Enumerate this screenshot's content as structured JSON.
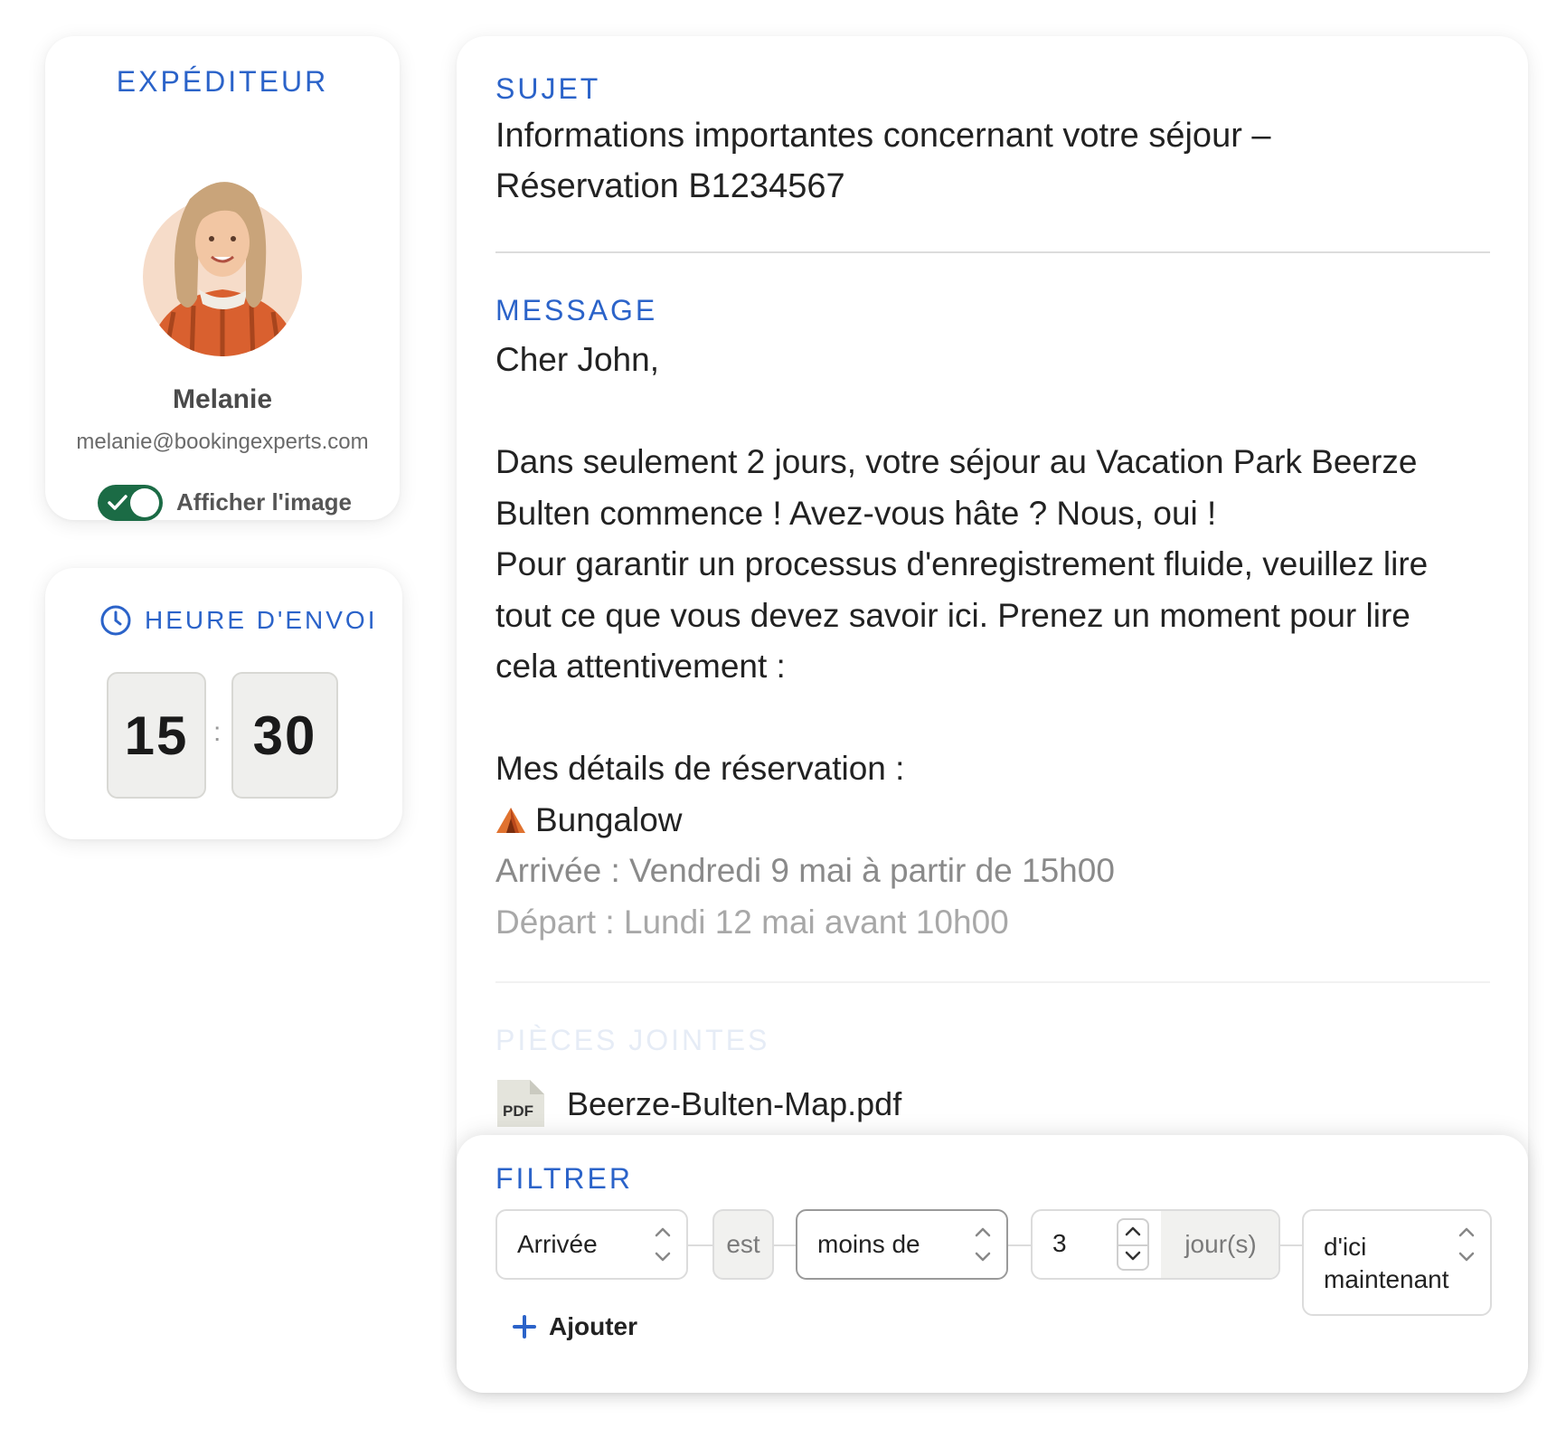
{
  "sender": {
    "label": "EXPÉDITEUR",
    "name": "Melanie",
    "email": "melanie@bookingexperts.com",
    "show_image_label": "Afficher l'image",
    "show_image_on": true
  },
  "send_time": {
    "label": "HEURE D'ENVOI",
    "hour": "15",
    "separator": ":",
    "minute": "30"
  },
  "email": {
    "subject_label": "SUJET",
    "subject_line1": "Informations importantes concernant votre séjour –",
    "subject_line2": "Réservation B1234567",
    "message_label": "MESSAGE",
    "greeting": "Cher John,",
    "para1_line1": "Dans seulement 2 jours, votre séjour au Vacation Park Beerze",
    "para1_line2": "Bulten commence ! Avez-vous hâte ? Nous, oui !",
    "para2_line1": "Pour garantir un processus d'enregistrement fluide, veuillez lire",
    "para2_line2": "tout ce que vous devez savoir ici. Prenez un moment pour lire",
    "para2_line3": "cela attentivement :",
    "details_title": "Mes détails de réservation :",
    "accommodation": "Bungalow",
    "arrival": "Arrivée : Vendredi 9 mai à partir de 15h00",
    "departure": "Départ : Lundi 12 mai avant 10h00",
    "attachments_label": "PIÈCES JOINTES",
    "attachment_type": "PDF",
    "attachment_name": "Beerze-Bulten-Map.pdf"
  },
  "filter": {
    "label": "FILTRER",
    "field": "Arrivée",
    "connector": "est",
    "operator": "moins de",
    "number": "3",
    "unit": "jour(s)",
    "relative_line1": "d'ici",
    "relative_line2": "maintenant",
    "add_label": "Ajouter"
  },
  "colors": {
    "accent_blue": "#2b63c9",
    "toggle_green": "#1b6b45"
  },
  "icons": {
    "clock": "clock-icon",
    "tent": "tent-icon",
    "pdf": "pdf-file-icon",
    "plus": "plus-icon",
    "check": "check-icon",
    "chevrons": "chevron-up-down-icon"
  }
}
